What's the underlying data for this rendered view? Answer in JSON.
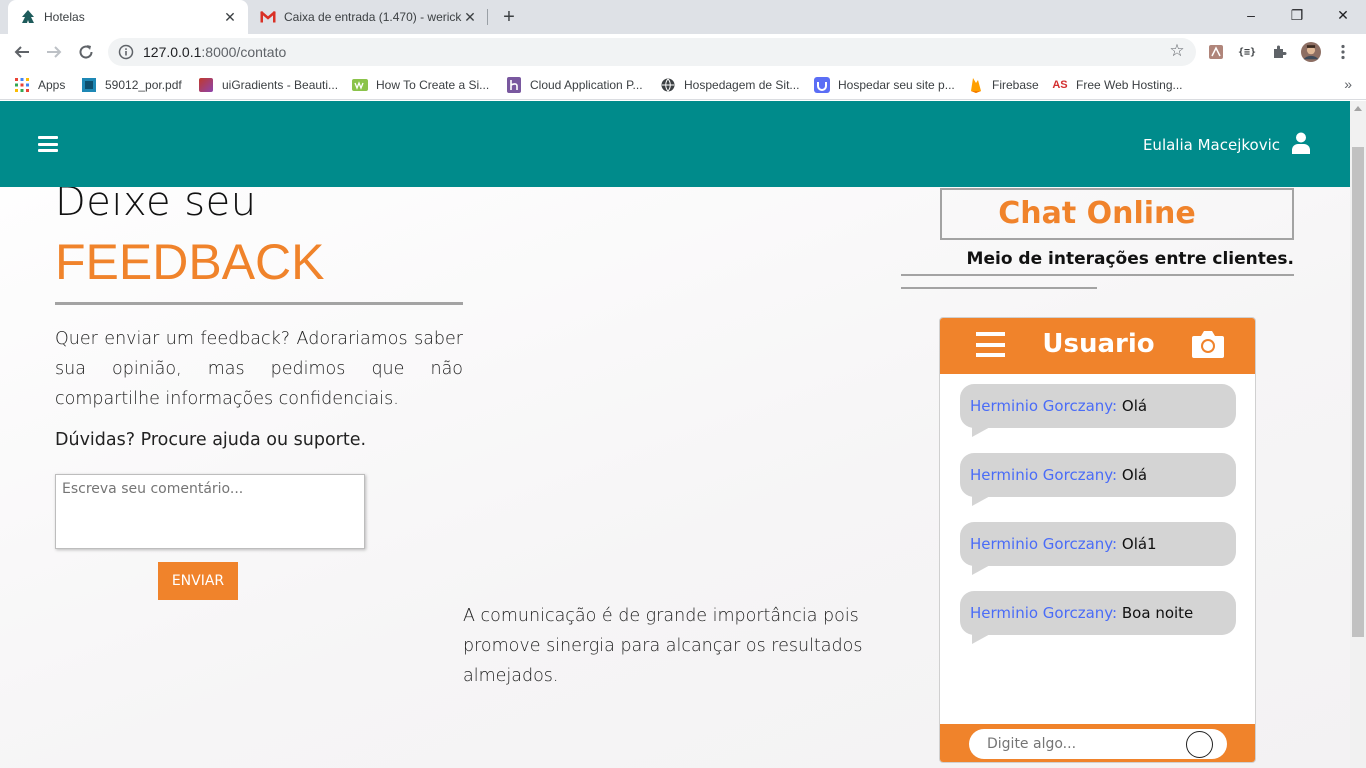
{
  "browser": {
    "tabs": [
      {
        "title": "Hotelas",
        "icon": "hotel-icon",
        "active": true
      },
      {
        "title": "Caixa de entrada (1.470) - werick",
        "icon": "gmail-icon",
        "active": false
      }
    ],
    "new_tab": "+",
    "window_controls": {
      "minimize": "–",
      "restore": "❐",
      "close": "✕"
    },
    "url_host": "127.0.0.1",
    "url_path": ":8000/contato",
    "bookmarks": [
      {
        "label": "Apps",
        "icon": "apps-grid-icon"
      },
      {
        "label": "59012_por.pdf",
        "icon": "pdf-file-icon"
      },
      {
        "label": "uiGradients - Beauti...",
        "icon": "uigradients-icon"
      },
      {
        "label": "How To Create a Si...",
        "icon": "how-to-icon"
      },
      {
        "label": "Cloud Application P...",
        "icon": "heroku-icon"
      },
      {
        "label": "Hospedagem de Sit...",
        "icon": "globe-icon"
      },
      {
        "label": "Hospedar seu site p...",
        "icon": "shield-bookmark-icon"
      },
      {
        "label": "Firebase",
        "icon": "firebase-icon"
      },
      {
        "label": "Free Web Hosting...",
        "icon": "freehosting-icon"
      }
    ],
    "bookmarks_more": "»"
  },
  "nav": {
    "user_name": "Eulalia Macejkovic"
  },
  "feedback": {
    "heading_line1": "Deixe seu",
    "heading_line2": "FEEDBACK",
    "paragraph": "Quer enviar um feedback? Adorariamos saber sua opinião, mas pedimos que não compartilhe informações confidenciais.",
    "help": "Dúvidas? Procure ajuda ou suporte.",
    "comment_placeholder": "Escreva seu comentário...",
    "send_label": "ENVIAR"
  },
  "communication_text": "A comunicação é de grande importância pois promove sinergia para alcançar os resultados almejados.",
  "chat": {
    "title": "Chat Online",
    "subtitle": "Meio de interações entre clientes.",
    "header_name": "Usuario",
    "messages": [
      {
        "author": "Herminio Gorczany:",
        "text": "Olá"
      },
      {
        "author": "Herminio Gorczany:",
        "text": "Olá"
      },
      {
        "author": "Herminio Gorczany:",
        "text": "Olá1"
      },
      {
        "author": "Herminio Gorczany:",
        "text": "Boa noite"
      }
    ],
    "input_placeholder": "Digite algo..."
  },
  "colors": {
    "navbar": "#008b8b",
    "accent": "#f0832b",
    "chat_author": "#4a6cf7",
    "bubble": "#d4d4d4"
  }
}
